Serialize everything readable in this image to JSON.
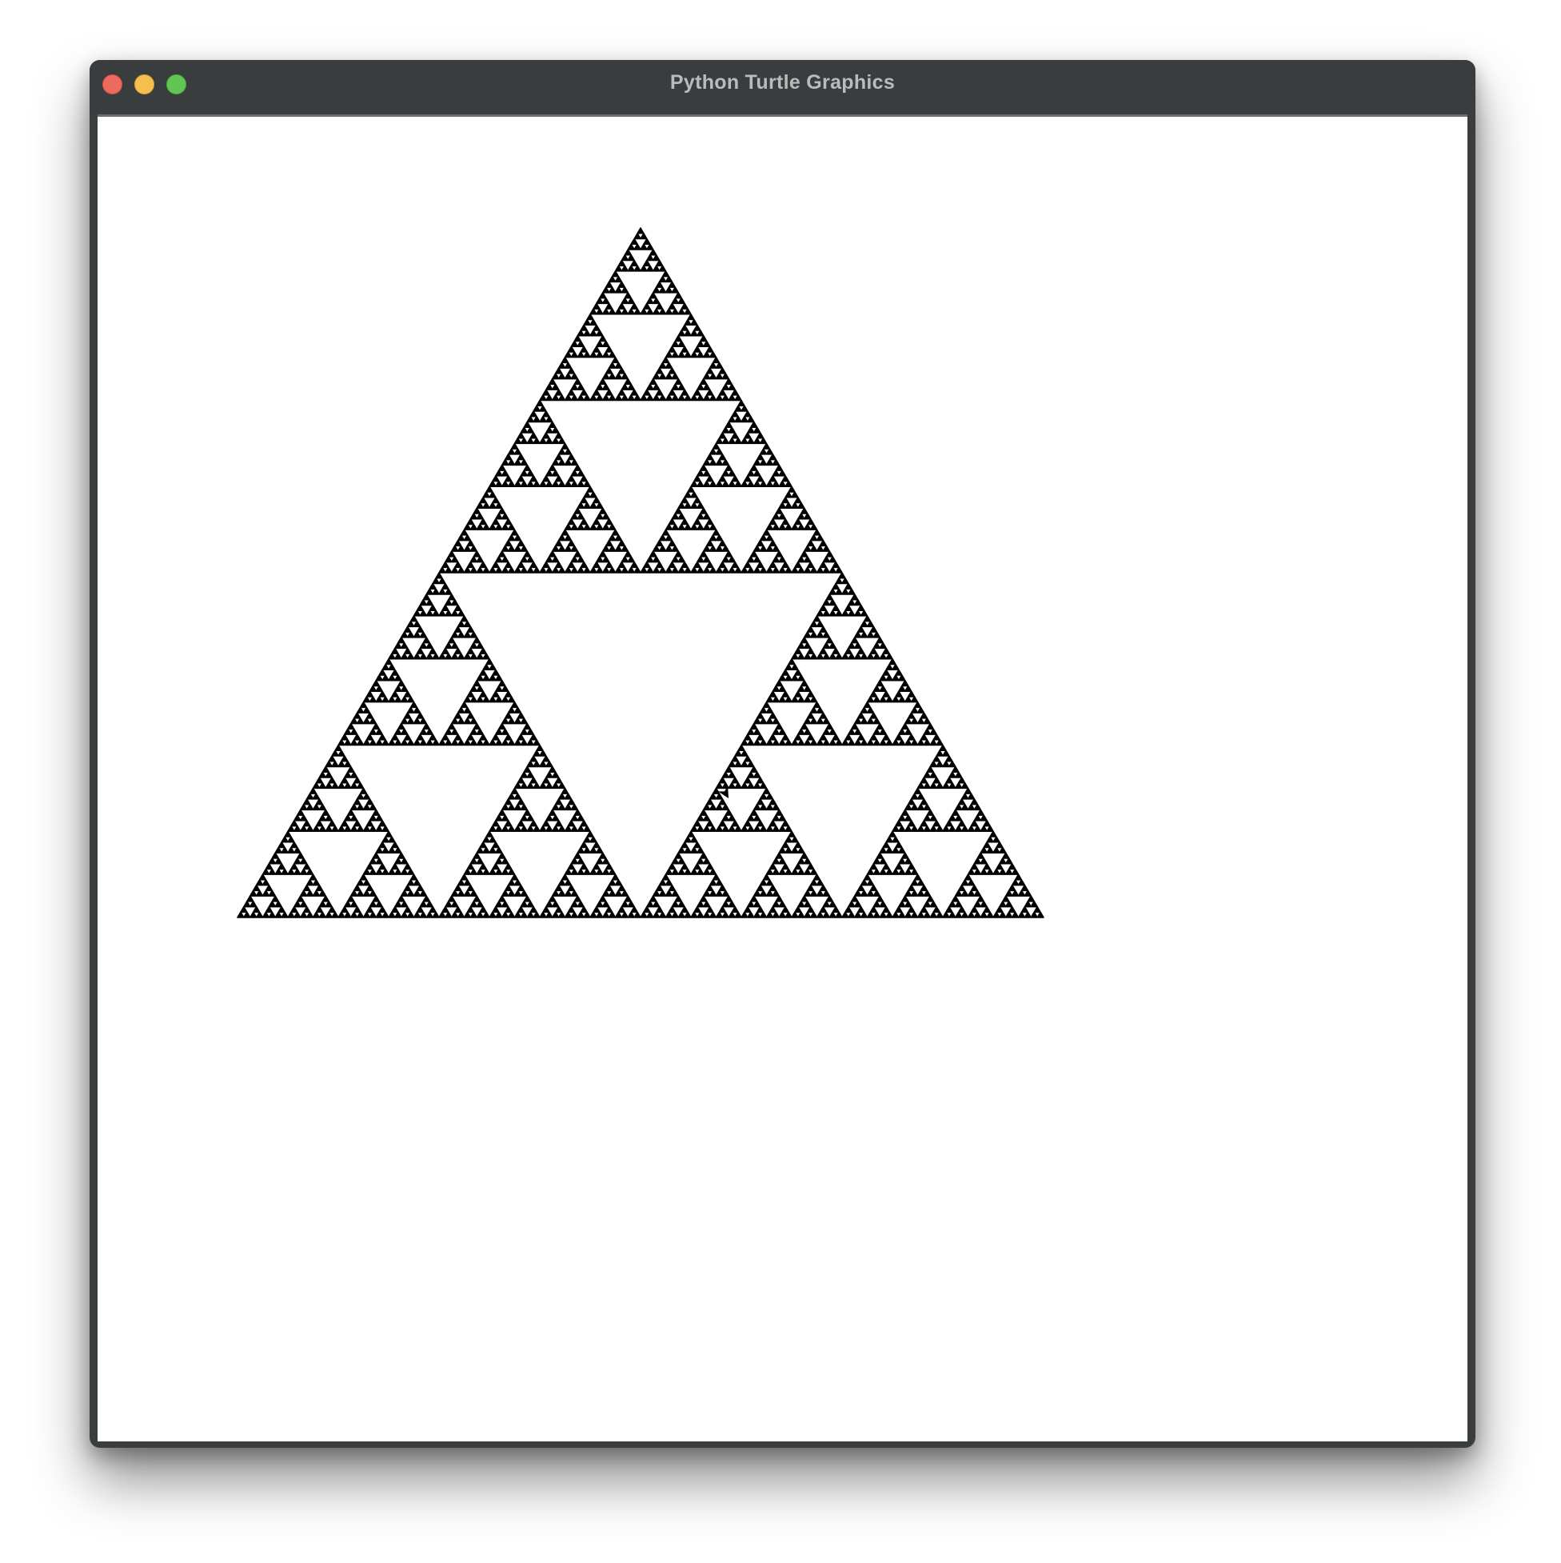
{
  "window": {
    "title": "Python Turtle Graphics",
    "controls": {
      "close_color": "#ed6a5e",
      "minimize_color": "#f5bf4f",
      "zoom_color": "#61c554"
    }
  },
  "canvas": {
    "background": "#ffffff",
    "drawing": {
      "shape": "sierpinski-triangle",
      "fill_color": "#000000",
      "recursion_depth": 7
    },
    "turtle_cursor": {
      "shape": "arrow",
      "color": "#000000"
    }
  }
}
